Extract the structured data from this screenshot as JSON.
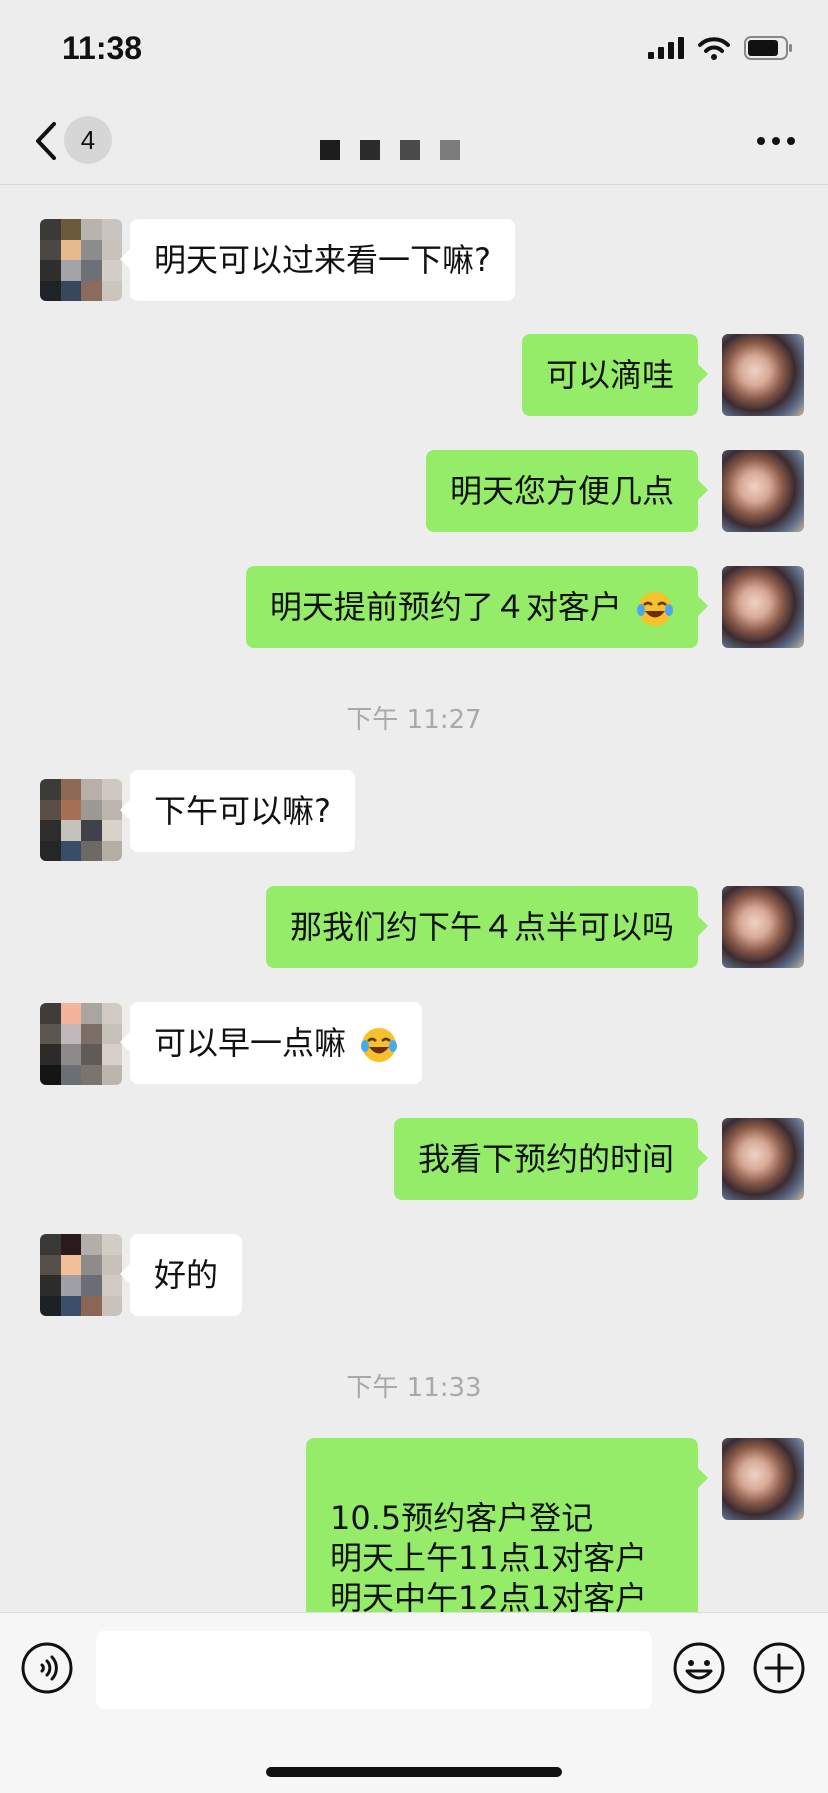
{
  "status": {
    "time": "11:38"
  },
  "nav": {
    "unread_count": "4"
  },
  "messages": [
    {
      "side": "in",
      "text": "明天可以过来看一下嘛?"
    },
    {
      "side": "out",
      "text": "可以滴哇"
    },
    {
      "side": "out",
      "text": "明天您方便几点"
    },
    {
      "side": "out",
      "text": "明天提前预约了４对客户",
      "emoji": "face-with-tears-of-joy"
    },
    {
      "side": "in",
      "text": "下午可以嘛?"
    },
    {
      "side": "out",
      "text": "那我们约下午４点半可以吗"
    },
    {
      "side": "in",
      "text": "可以早一点嘛",
      "emoji": "face-with-tears-of-joy"
    },
    {
      "side": "out",
      "text": "我看下预约的时间"
    },
    {
      "side": "in",
      "text": "好的"
    },
    {
      "side": "out",
      "lines": [
        "10.5预约客户登记",
        "明天上午11点1对客户",
        "明天中午12点1对客户"
      ]
    }
  ],
  "timestamps": [
    "下午 11:27",
    "下午 11:33"
  ],
  "colors": {
    "bg": "#ededed",
    "outgoing": "#95ec69",
    "incoming": "#ffffff",
    "timestamp": "#a9a9a9"
  }
}
